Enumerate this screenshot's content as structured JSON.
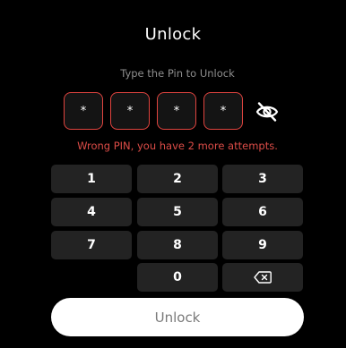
{
  "header": {
    "title": "Unlock",
    "subtitle": "Type the Pin to Unlock"
  },
  "pin": {
    "slots": [
      "*",
      "*",
      "*",
      "*"
    ],
    "visibility_icon": "eye-off-icon",
    "error_message": "Wrong PIN, you have 2 more attempts.",
    "error_color": "#dc4c47",
    "slot_border_color": "#e0443f"
  },
  "keypad": {
    "rows": [
      [
        "1",
        "2",
        "3"
      ],
      [
        "4",
        "5",
        "6"
      ],
      [
        "7",
        "8",
        "9"
      ],
      [
        "",
        "0",
        "backspace"
      ]
    ],
    "backspace_icon": "backspace-icon",
    "key_color": "#232323"
  },
  "actions": {
    "unlock_label": "Unlock"
  }
}
